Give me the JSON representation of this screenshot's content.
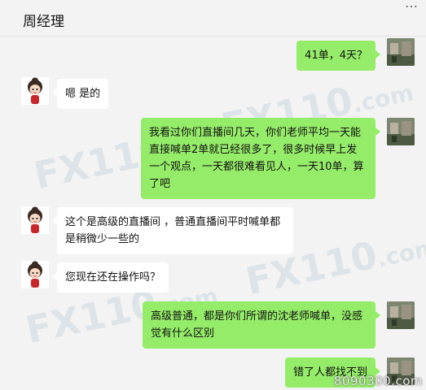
{
  "header": {
    "title": "周经理"
  },
  "messages": [
    {
      "side": "me",
      "text": "41单，4天？"
    },
    {
      "side": "other",
      "text": "嗯 是的"
    },
    {
      "side": "me",
      "text": "我看过你们直播间几天，你们老师平均一天能直接喊单2单就已经很多了，很多时候早上发一个观点，一天都很难看见人，一天10单，算了吧"
    },
    {
      "side": "other",
      "text": "这个是高级的直播间 ，普通直播间平时喊单都是稍微少一些的"
    },
    {
      "side": "other",
      "text": "您现在还在操作吗？"
    },
    {
      "side": "me",
      "text": "高级普通，都是你们所谓的沈老师喊单，没感觉有什么区别"
    },
    {
      "side": "me",
      "text": "错了人都找不到"
    }
  ],
  "watermarks": {
    "logo": "FX110.com",
    "corner": "8090300.com"
  },
  "colors": {
    "my_bubble": "#95ec69",
    "other_bubble": "#ffffff",
    "background": "#f3f3f3"
  }
}
